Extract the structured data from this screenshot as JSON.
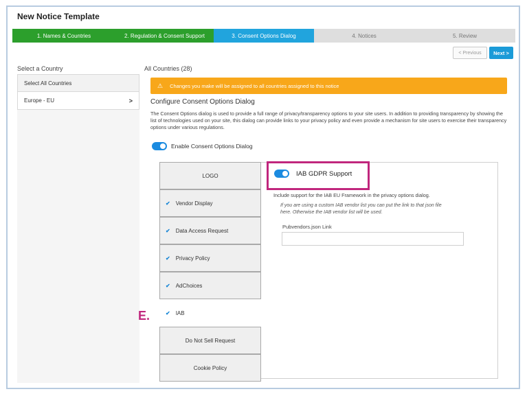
{
  "title": "New Notice Template",
  "stepper": {
    "steps": [
      {
        "label": "1. Names & Countries",
        "state": "done"
      },
      {
        "label": "2. Regulation & Consent Support",
        "state": "done"
      },
      {
        "label": "3. Consent Options Dialog",
        "state": "active"
      },
      {
        "label": "4. Notices",
        "state": "todo"
      },
      {
        "label": "5. Review",
        "state": "todo"
      }
    ]
  },
  "nav": {
    "previous": "< Previous",
    "next": "Next >"
  },
  "left": {
    "label": "Select a Country",
    "select_all": "Select All Countries",
    "countries": [
      {
        "label": "Europe - EU",
        "chevron": ">"
      }
    ]
  },
  "main": {
    "all_countries": "All Countries (28)",
    "warning": "Changes you make will be assigned to all countries assigned to this notice",
    "section_title": "Configure Consent Options Dialog",
    "description": "The Consent Options dialog is used to provide a full range of privacy/transparency options to your site users. In addition to providing transparency by showing the list of technologies used on your site, this dialog can provide links to your privacy policy and even provide a mechanism for site users to exercise their transparency options under various regulations.",
    "enable_label": "Enable Consent Options Dialog",
    "enable_on": true
  },
  "tabs": [
    {
      "label": "LOGO",
      "checked": false
    },
    {
      "label": "Vendor Display",
      "checked": true
    },
    {
      "label": "Data Access Request",
      "checked": true
    },
    {
      "label": "Privacy Policy",
      "checked": true
    },
    {
      "label": "AdChoices",
      "checked": true
    },
    {
      "label": "IAB",
      "checked": true,
      "selected": true
    },
    {
      "label": "Do Not Sell Request",
      "checked": false
    },
    {
      "label": "Cookie Policy",
      "checked": false
    }
  ],
  "annotation": "E.",
  "iab": {
    "toggle_label": "IAB GDPR Support",
    "toggle_on": true,
    "description": "Include support for the IAB EU Framework in the privacy options dialog.",
    "note": "If you are using a custom IAB vendor list you can put the link to that json file here. Otherwise the IAB vendor list will be used.",
    "pub_label": "Pubvendors.json Link",
    "pub_value": ""
  },
  "colors": {
    "done": "#2c9f2c",
    "active": "#21a4dd",
    "highlight": "#c0267d",
    "warning": "#f8a71a"
  }
}
